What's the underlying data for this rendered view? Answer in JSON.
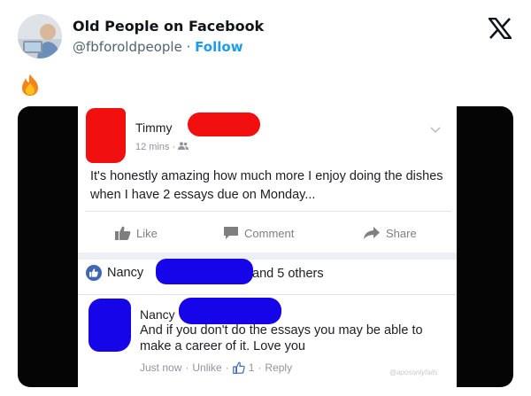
{
  "tweet": {
    "account_name": "Old People on Facebook",
    "handle": "@fbforoldpeople",
    "separator": "·",
    "follow_label": "Follow",
    "reaction_emoji": "fire-emoji"
  },
  "fb_post": {
    "author": {
      "name_prefix": "Timmy",
      "time": "12 mins",
      "dot": "·",
      "audience_icon": "friends-icon"
    },
    "text": "It's honestly amazing how much more I enjoy doing the dishes when I have 2 essays due on Monday...",
    "actions": {
      "like_label": "Like",
      "comment_label": "Comment",
      "share_label": "Share"
    },
    "likes": {
      "first_name": "Nancy",
      "others_text": "and 5 others"
    },
    "comment": {
      "name": "Nancy",
      "text": "And if you don't do the essays you may be able to make a career of it.  Love you",
      "meta": {
        "time": "Just now",
        "unlike_label": "Unlike",
        "like_count": "1",
        "reply_label": "Reply",
        "dot": "·"
      }
    },
    "watermark": "@aposonlyfails"
  },
  "colors": {
    "redact_red": "#f10f0f",
    "redact_blue": "#1505e8",
    "follow_blue": "#1d9bf0",
    "fb_blue": "#4267b2"
  }
}
